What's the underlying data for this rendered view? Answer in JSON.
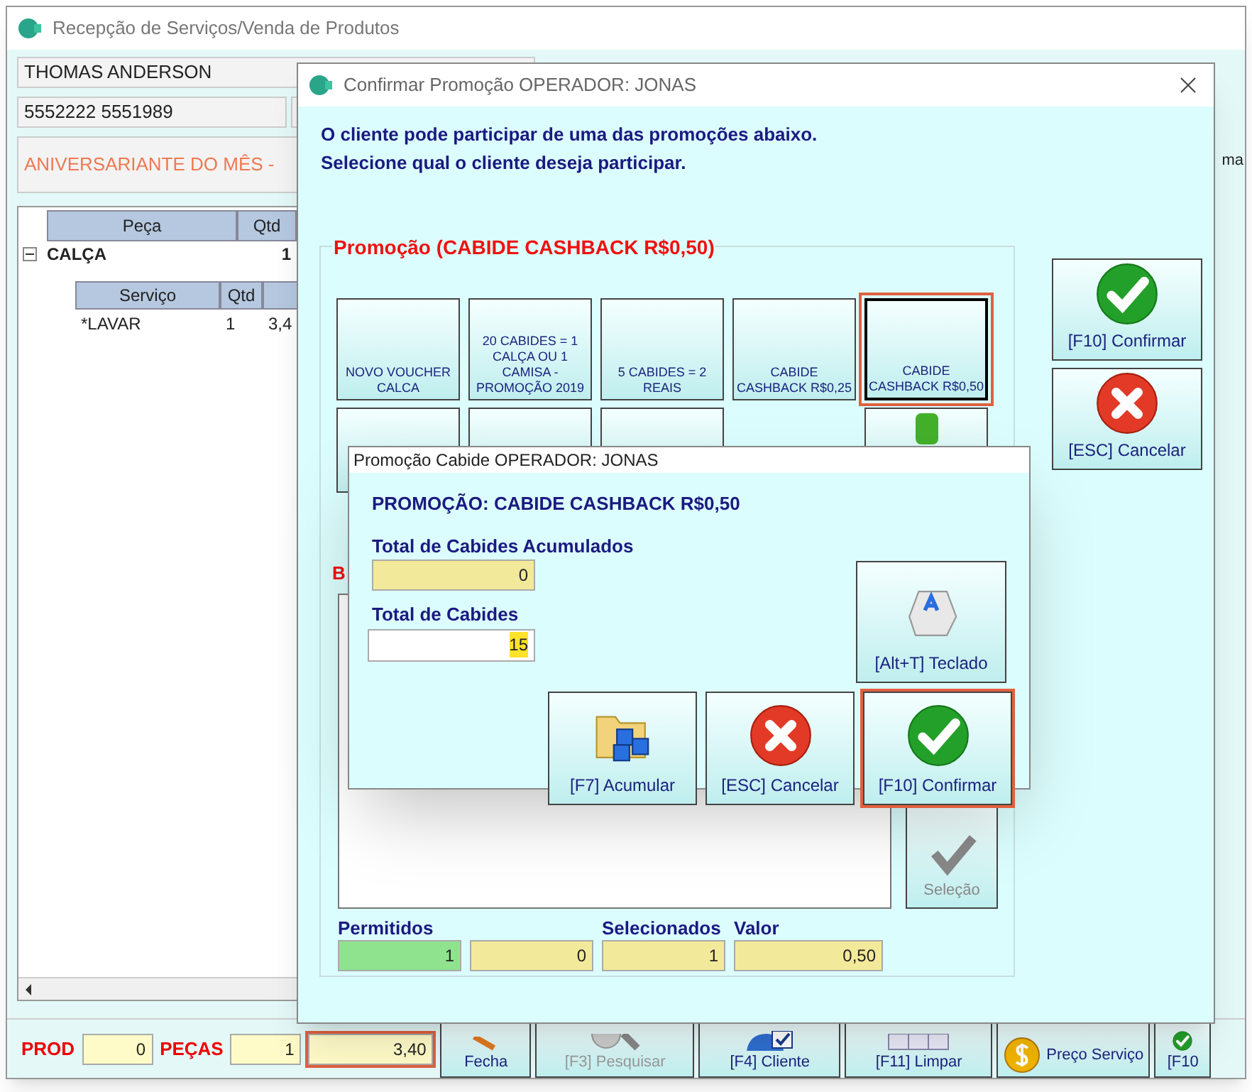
{
  "main_window": {
    "title": "Recepção de Serviços/Venda de Produtos",
    "customer": {
      "name": "THOMAS ANDERSON",
      "phones": "5552222  5551989",
      "birthday": "ANIVERSARIANTE DO MÊS  -"
    },
    "tree": {
      "columns": [
        "Peça",
        "Qtd"
      ],
      "rows": [
        {
          "piece": "CALÇA",
          "qty": "1",
          "expanded": true,
          "sub_columns": [
            "Serviço",
            "Qtd"
          ],
          "children": [
            {
              "service": "*LAVAR",
              "qty": "1",
              "value": "3,4"
            }
          ]
        }
      ]
    },
    "totals": {
      "prod_label": "PROD",
      "prod": "0",
      "pecas_label": "PEÇAS",
      "pecas": "1",
      "total": "3,40"
    },
    "toolbar": [
      {
        "label": "Fecha",
        "disabled": false
      },
      {
        "label": "[F3] Pesquisar",
        "disabled": true
      },
      {
        "label": "[F4] Cliente",
        "disabled": false
      },
      {
        "label": "[F11] Limpar",
        "disabled": false
      },
      {
        "label": "Preço Serviço",
        "disabled": false
      },
      {
        "label": "[F10",
        "disabled": false
      }
    ],
    "side_label": "ma"
  },
  "promo_dialog": {
    "title": "Confirmar Promoção OPERADOR: JONAS",
    "message": [
      "O cliente pode participar de uma das promoções abaixo.",
      "Selecione qual o cliente deseja participar."
    ],
    "group_title": "Promoção (CABIDE CASHBACK R$0,50)",
    "promotions": [
      {
        "label": "NOVO VOUCHER CALCA",
        "selected": false
      },
      {
        "label": "20 CABIDES = 1 CALÇA OU 1 CAMISA - PROMOÇÃO 2019",
        "selected": false
      },
      {
        "label": "5 CABIDES = 2 REAIS",
        "selected": false
      },
      {
        "label": "CABIDE CASHBACK R$0,25",
        "selected": false
      },
      {
        "label": "CABIDE CASHBACK R$0,50",
        "selected": true
      }
    ],
    "section_label": "B",
    "selection_button": {
      "label": "Seleção",
      "disabled": true
    },
    "summary": [
      {
        "label": "Permitidos",
        "value": "1",
        "kind": "ok"
      },
      {
        "value": "0",
        "kind": "plain"
      },
      {
        "label": "Selecionados",
        "value": "1",
        "kind": "plain"
      },
      {
        "label": "Valor",
        "value": "0,50",
        "kind": "wide"
      }
    ],
    "actions": [
      {
        "label": "[F10] Confirmar"
      },
      {
        "label": "[ESC] Cancelar"
      }
    ]
  },
  "cabide_dialog": {
    "title": "Promoção Cabide OPERADOR: JONAS",
    "heading": "PROMOÇÃO: CABIDE CASHBACK R$0,50",
    "accumulated": {
      "label": "Total de Cabides Acumulados",
      "value": "0"
    },
    "total": {
      "label": "Total de Cabides",
      "value": "15"
    },
    "keyboard_button": {
      "label": "[Alt+T] Teclado"
    },
    "buttons": [
      {
        "label": "[F7] Acumular",
        "focused": false
      },
      {
        "label": "[ESC] Cancelar",
        "focused": false
      },
      {
        "label": "[F10] Confirmar",
        "focused": true
      }
    ]
  }
}
